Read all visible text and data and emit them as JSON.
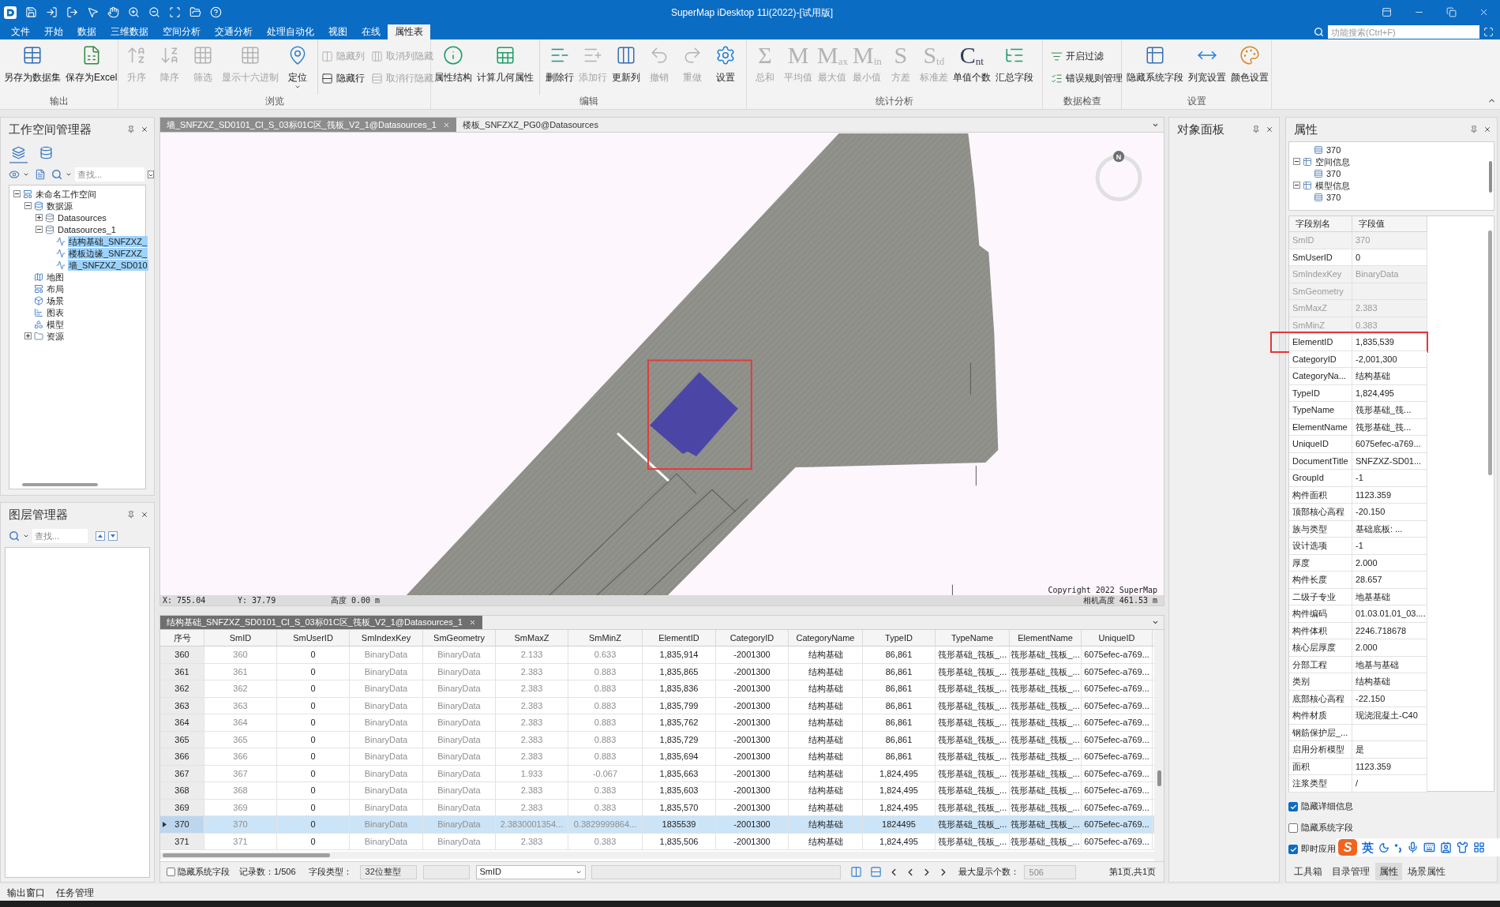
{
  "window": {
    "title": "SuperMap iDesktop 11i(2022)-[试用版]"
  },
  "menu_tabs": [
    {
      "label": "文件",
      "selected": false
    },
    {
      "label": "开始",
      "selected": false
    },
    {
      "label": "数据",
      "selected": false
    },
    {
      "label": "三维数据",
      "selected": false
    },
    {
      "label": "空间分析",
      "selected": false
    },
    {
      "label": "交通分析",
      "selected": false
    },
    {
      "label": "处理自动化",
      "selected": false
    },
    {
      "label": "视图",
      "selected": false
    },
    {
      "label": "在线",
      "selected": false
    },
    {
      "label": "属性表",
      "selected": true
    }
  ],
  "search": {
    "placeholder": "功能搜索(Ctrl+F)"
  },
  "ribbon": [
    {
      "label": "输出",
      "sections": [
        [
          {
            "kind": "icon",
            "label": "另存为数据集",
            "disabled": false
          },
          {
            "kind": "icon",
            "label": "保存为Excel",
            "disabled": false
          }
        ]
      ]
    },
    {
      "label": "浏览",
      "sections": [
        [
          {
            "kind": "icon",
            "label": "升序",
            "disabled": true
          },
          {
            "kind": "icon",
            "label": "降序",
            "disabled": true
          },
          {
            "kind": "icon",
            "label": "筛选",
            "disabled": true
          },
          {
            "kind": "icon",
            "label": "显示十六进制",
            "disabled": true
          },
          {
            "kind": "split",
            "label": "定位",
            "disabled": false
          }
        ],
        [
          {
            "kind": "small",
            "label": "隐藏列",
            "disabled": true
          },
          {
            "kind": "small",
            "label": "隐藏行",
            "disabled": false
          },
          {
            "kind": "small",
            "label": "取消列隐藏",
            "disabled": true
          },
          {
            "kind": "small",
            "label": "取消行隐藏",
            "disabled": true
          }
        ]
      ]
    },
    {
      "label": "编辑",
      "sections": [
        [
          {
            "kind": "icon",
            "label": "属性结构",
            "disabled": false
          },
          {
            "kind": "icon",
            "label": "计算几何属性",
            "disabled": false
          }
        ],
        [
          {
            "kind": "icon",
            "label": "删除行",
            "disabled": false
          },
          {
            "kind": "icon",
            "label": "添加行",
            "disabled": true
          },
          {
            "kind": "icon",
            "label": "更新列",
            "disabled": false
          },
          {
            "kind": "icon",
            "label": "撤销",
            "disabled": true
          },
          {
            "kind": "icon",
            "label": "重做",
            "disabled": true
          },
          {
            "kind": "icon",
            "label": "设置",
            "disabled": false
          }
        ]
      ]
    },
    {
      "label": "统计分析",
      "sections": [
        [
          {
            "kind": "glyph",
            "glyph": "Σ",
            "label": "总和",
            "disabled": true
          },
          {
            "kind": "glyph",
            "glyph": "M",
            "label": "平均值",
            "disabled": true
          },
          {
            "kind": "glyph",
            "glyph": "M",
            "sub": "ax",
            "label": "最大值",
            "disabled": true
          },
          {
            "kind": "glyph",
            "glyph": "M",
            "sub": "in",
            "label": "最小值",
            "disabled": true
          },
          {
            "kind": "glyph",
            "glyph": "S",
            "label": "方差",
            "disabled": true
          },
          {
            "kind": "glyph",
            "glyph": "S",
            "sub": "td",
            "label": "标准差",
            "disabled": true
          },
          {
            "kind": "glyph",
            "glyph": "C",
            "sub": "nt",
            "label": "单值个数",
            "disabled": false
          },
          {
            "kind": "icon",
            "label": "汇总字段",
            "disabled": false
          }
        ]
      ]
    },
    {
      "label": "数据检查",
      "sections": [
        [
          {
            "kind": "small",
            "label": "开启过滤",
            "disabled": false
          },
          {
            "kind": "small",
            "label": "错误规则管理",
            "disabled": false
          }
        ]
      ]
    },
    {
      "label": "设置",
      "sections": [
        [
          {
            "kind": "icon",
            "label": "隐藏系统字段",
            "disabled": false
          },
          {
            "kind": "icon",
            "label": "列宽设置",
            "disabled": false
          },
          {
            "kind": "icon",
            "label": "颜色设置",
            "disabled": false
          }
        ]
      ]
    }
  ],
  "workspace_manager": {
    "title": "工作空间管理器",
    "view_tabs": [
      {
        "selected": true
      },
      {
        "selected": false
      }
    ],
    "search": {
      "placeholder": "查找..."
    },
    "tree": [
      {
        "label": "未命名工作空间",
        "kind": "workspace",
        "expanded": true,
        "selected": false,
        "children": [
          {
            "label": "数据源",
            "kind": "datasources",
            "expanded": true,
            "selected": false,
            "children": [
              {
                "label": "Datasources",
                "kind": "datasource",
                "expanded": false,
                "selected": false
              },
              {
                "label": "Datasources_1",
                "kind": "datasource",
                "expanded": true,
                "selected": false,
                "children": [
                  {
                    "label": "结构基础_SNFZXZ_",
                    "kind": "dataset",
                    "selected": true
                  },
                  {
                    "label": "楼板边缘_SNFZXZ_",
                    "kind": "dataset",
                    "selected": true
                  },
                  {
                    "label": "墙_SNFZXZ_SD010",
                    "kind": "dataset",
                    "selected": true
                  }
                ]
              }
            ]
          },
          {
            "label": "地图",
            "kind": "maps",
            "selected": false
          },
          {
            "label": "布局",
            "kind": "layouts",
            "selected": false
          },
          {
            "label": "场景",
            "kind": "scenes",
            "selected": false
          },
          {
            "label": "图表",
            "kind": "charts",
            "selected": false
          },
          {
            "label": "模型",
            "kind": "models",
            "selected": false
          },
          {
            "label": "资源",
            "kind": "resources",
            "expanded": false,
            "selected": false
          }
        ]
      }
    ]
  },
  "layer_manager": {
    "title": "图层管理器",
    "search": {
      "placeholder": "查找..."
    }
  },
  "documents": [
    {
      "label": "墙_SNFZXZ_SD0101_CI_S_03标01C区_筏板_V2_1@Datasources_1",
      "selected": true
    },
    {
      "label": "楼板_SNFZXZ_PG0@Datasources",
      "selected": false
    }
  ],
  "scene": {
    "north_label": "N",
    "x": "X: 755.04",
    "y": "Y: 37.79",
    "height": "高度 0.00 m",
    "copyright": "Copyright 2022 SuperMap",
    "camera_height": "相机高度 461.53 m"
  },
  "attribute_table": {
    "tab": {
      "label": "结构基础_SNFZXZ_SD0101_CI_S_03标01C区_筏板_V2_1@Datasources_1",
      "selected": true
    },
    "columns": [
      {
        "label": "序号",
        "kind": "index"
      },
      {
        "label": "SmID",
        "kind": "system"
      },
      {
        "label": "SmUserID",
        "kind": "field"
      },
      {
        "label": "SmIndexKey",
        "kind": "system"
      },
      {
        "label": "SmGeometry",
        "kind": "system"
      },
      {
        "label": "SmMaxZ",
        "kind": "system"
      },
      {
        "label": "SmMinZ",
        "kind": "system"
      },
      {
        "label": "ElementID",
        "kind": "field"
      },
      {
        "label": "CategoryID",
        "kind": "field"
      },
      {
        "label": "CategoryName",
        "kind": "field"
      },
      {
        "label": "TypeID",
        "kind": "field"
      },
      {
        "label": "TypeName",
        "kind": "field"
      },
      {
        "label": "ElementName",
        "kind": "field"
      },
      {
        "label": "UniqueID",
        "kind": "field"
      }
    ],
    "rows": [
      {
        "selected": false,
        "cells": [
          "360",
          "360",
          "0",
          "BinaryData",
          "BinaryData",
          "2.133",
          "0.633",
          "1,835,914",
          "-2001300",
          "结构基础",
          "86,861",
          "筏形基础_筏板_...",
          "筏形基础_筏板_...",
          "6075efec-a769..."
        ]
      },
      {
        "selected": false,
        "cells": [
          "361",
          "361",
          "0",
          "BinaryData",
          "BinaryData",
          "2.383",
          "0.883",
          "1,835,865",
          "-2001300",
          "结构基础",
          "86,861",
          "筏形基础_筏板_...",
          "筏形基础_筏板_...",
          "6075efec-a769..."
        ]
      },
      {
        "selected": false,
        "cells": [
          "362",
          "362",
          "0",
          "BinaryData",
          "BinaryData",
          "2.383",
          "0.883",
          "1,835,836",
          "-2001300",
          "结构基础",
          "86,861",
          "筏形基础_筏板_...",
          "筏形基础_筏板_...",
          "6075efec-a769..."
        ]
      },
      {
        "selected": false,
        "cells": [
          "363",
          "363",
          "0",
          "BinaryData",
          "BinaryData",
          "2.383",
          "0.883",
          "1,835,799",
          "-2001300",
          "结构基础",
          "86,861",
          "筏形基础_筏板_...",
          "筏形基础_筏板_...",
          "6075efec-a769..."
        ]
      },
      {
        "selected": false,
        "cells": [
          "364",
          "364",
          "0",
          "BinaryData",
          "BinaryData",
          "2.383",
          "0.883",
          "1,835,762",
          "-2001300",
          "结构基础",
          "86,861",
          "筏形基础_筏板_...",
          "筏形基础_筏板_...",
          "6075efec-a769..."
        ]
      },
      {
        "selected": false,
        "cells": [
          "365",
          "365",
          "0",
          "BinaryData",
          "BinaryData",
          "2.383",
          "0.883",
          "1,835,729",
          "-2001300",
          "结构基础",
          "86,861",
          "筏形基础_筏板_...",
          "筏形基础_筏板_...",
          "6075efec-a769..."
        ]
      },
      {
        "selected": false,
        "cells": [
          "366",
          "366",
          "0",
          "BinaryData",
          "BinaryData",
          "2.383",
          "0.883",
          "1,835,694",
          "-2001300",
          "结构基础",
          "86,861",
          "筏形基础_筏板_...",
          "筏形基础_筏板_...",
          "6075efec-a769..."
        ]
      },
      {
        "selected": false,
        "cells": [
          "367",
          "367",
          "0",
          "BinaryData",
          "BinaryData",
          "1.933",
          "-0.067",
          "1,835,663",
          "-2001300",
          "结构基础",
          "1,824,495",
          "筏形基础_筏板_...",
          "筏形基础_筏板_...",
          "6075efec-a769..."
        ]
      },
      {
        "selected": false,
        "cells": [
          "368",
          "368",
          "0",
          "BinaryData",
          "BinaryData",
          "2.383",
          "0.383",
          "1,835,603",
          "-2001300",
          "结构基础",
          "1,824,495",
          "筏形基础_筏板_...",
          "筏形基础_筏板_...",
          "6075efec-a769..."
        ]
      },
      {
        "selected": false,
        "cells": [
          "369",
          "369",
          "0",
          "BinaryData",
          "BinaryData",
          "2.383",
          "0.383",
          "1,835,570",
          "-2001300",
          "结构基础",
          "1,824,495",
          "筏形基础_筏板_...",
          "筏形基础_筏板_...",
          "6075efec-a769..."
        ]
      },
      {
        "selected": true,
        "cells": [
          "370",
          "370",
          "0",
          "BinaryData",
          "BinaryData",
          "2.3830001354...",
          "0.3829999864...",
          "1835539",
          "-2001300",
          "结构基础",
          "1824495",
          "筏形基础_筏板_...",
          "筏形基础_筏板_...",
          "6075efec-a769..."
        ]
      },
      {
        "selected": false,
        "cells": [
          "371",
          "371",
          "0",
          "BinaryData",
          "BinaryData",
          "2.383",
          "0.383",
          "1,835,506",
          "-2001300",
          "结构基础",
          "1,824,495",
          "筏形基础_筏板_...",
          "筏形基础_筏板_...",
          "6075efec-a769..."
        ]
      }
    ],
    "footer": {
      "hide_system_fields": {
        "label": "隐藏系统字段",
        "checked": false
      },
      "record_count": "记录数：1/506",
      "field_type_label": "字段类型：",
      "field_type_value": "32位整型",
      "field_select": "SmID",
      "max_display_label": "最大显示个数：",
      "max_display_value": "506",
      "page_info": "第1页,共1页"
    }
  },
  "object_panel": {
    "title": "对象面板"
  },
  "properties": {
    "title": "属性",
    "tree": [
      {
        "children": [
          {
            "label": "370",
            "kind": "record"
          }
        ]
      },
      {
        "label": "空间信息",
        "kind": "group",
        "expanded": true,
        "children": [
          {
            "label": "370",
            "kind": "record"
          }
        ]
      },
      {
        "label": "模型信息",
        "kind": "group",
        "expanded": true,
        "children": [
          {
            "label": "370",
            "kind": "record"
          }
        ]
      }
    ],
    "grid": {
      "columns": [
        "字段别名",
        "字段值"
      ],
      "rows": [
        {
          "name": "SmID",
          "value": "370",
          "readonly": true,
          "highlighted": false
        },
        {
          "name": "SmUserID",
          "value": "0",
          "readonly": false,
          "highlighted": false
        },
        {
          "name": "SmIndexKey",
          "value": "BinaryData",
          "readonly": true,
          "highlighted": false
        },
        {
          "name": "SmGeometry",
          "readonly": true,
          "highlighted": false
        },
        {
          "name": "SmMaxZ",
          "value": "2.383",
          "readonly": true,
          "highlighted": false
        },
        {
          "name": "SmMinZ",
          "value": "0.383",
          "readonly": true,
          "highlighted": false
        },
        {
          "name": "ElementID",
          "value": "1,835,539",
          "readonly": false,
          "highlighted": true
        },
        {
          "name": "CategoryID",
          "value": "-2,001,300",
          "readonly": false,
          "highlighted": false
        },
        {
          "name": "CategoryNa...",
          "value": "结构基础",
          "readonly": false,
          "highlighted": false
        },
        {
          "name": "TypeID",
          "value": "1,824,495",
          "readonly": false,
          "highlighted": false
        },
        {
          "name": "TypeName",
          "value": "筏形基础_筏...",
          "readonly": false,
          "highlighted": false
        },
        {
          "name": "ElementName",
          "value": "筏形基础_筏...",
          "readonly": false,
          "highlighted": false
        },
        {
          "name": "UniqueID",
          "value": "6075efec-a769...",
          "readonly": false,
          "highlighted": false
        },
        {
          "name": "DocumentTitle",
          "value": "SNFZXZ-SD01...",
          "readonly": false,
          "highlighted": false
        },
        {
          "name": "GroupId",
          "value": "-1",
          "readonly": false,
          "highlighted": false
        },
        {
          "name": "构件面积",
          "value": "1123.359",
          "readonly": false,
          "highlighted": false
        },
        {
          "name": "顶部核心高程",
          "value": "-20.150",
          "readonly": false,
          "highlighted": false
        },
        {
          "name": "族与类型",
          "value": "基础底板: ...",
          "readonly": false,
          "highlighted": false
        },
        {
          "name": "设计选项",
          "value": "-1",
          "readonly": false,
          "highlighted": false
        },
        {
          "name": "厚度",
          "value": "2.000",
          "readonly": false,
          "highlighted": false
        },
        {
          "name": "构件长度",
          "value": "28.657",
          "readonly": false,
          "highlighted": false
        },
        {
          "name": "二级子专业",
          "value": "地基基础",
          "readonly": false,
          "highlighted": false
        },
        {
          "name": "构件编码",
          "value": "01.03.01.01_03....",
          "readonly": false,
          "highlighted": false
        },
        {
          "name": "构件体积",
          "value": "2246.718678",
          "readonly": false,
          "highlighted": false
        },
        {
          "name": "核心层厚度",
          "value": "2.000",
          "readonly": false,
          "highlighted": false
        },
        {
          "name": "分部工程",
          "value": "地基与基础",
          "readonly": false,
          "highlighted": false
        },
        {
          "name": "类别",
          "value": "结构基础",
          "readonly": false,
          "highlighted": false
        },
        {
          "name": "底部核心高程",
          "value": "-22.150",
          "readonly": false,
          "highlighted": false
        },
        {
          "name": "构件材质",
          "value": "现浇混凝土-C40",
          "readonly": false,
          "highlighted": false
        },
        {
          "name": "钢筋保护层_...",
          "readonly": false,
          "highlighted": false
        },
        {
          "name": "启用分析模型",
          "value": "是",
          "readonly": false,
          "highlighted": false
        },
        {
          "name": "面积",
          "value": "1123.359",
          "readonly": false,
          "highlighted": false
        },
        {
          "name": "注浆类型",
          "value": "/",
          "readonly": false,
          "highlighted": false
        }
      ]
    },
    "options": [
      {
        "label": "隐藏详细信息",
        "checked": true
      },
      {
        "label": "隐藏系统字段",
        "checked": false
      },
      {
        "label": "即时应用",
        "checked": true
      }
    ],
    "tabs": [
      {
        "label": "工具箱",
        "selected": false
      },
      {
        "label": "目录管理",
        "selected": false
      },
      {
        "label": "属性",
        "selected": true
      },
      {
        "label": "场景属性",
        "selected": false
      }
    ]
  },
  "input_method_bar": {
    "logo": "S",
    "mode": "英"
  },
  "status_bar": [
    {
      "label": "输出窗口"
    },
    {
      "label": "任务管理"
    }
  ]
}
